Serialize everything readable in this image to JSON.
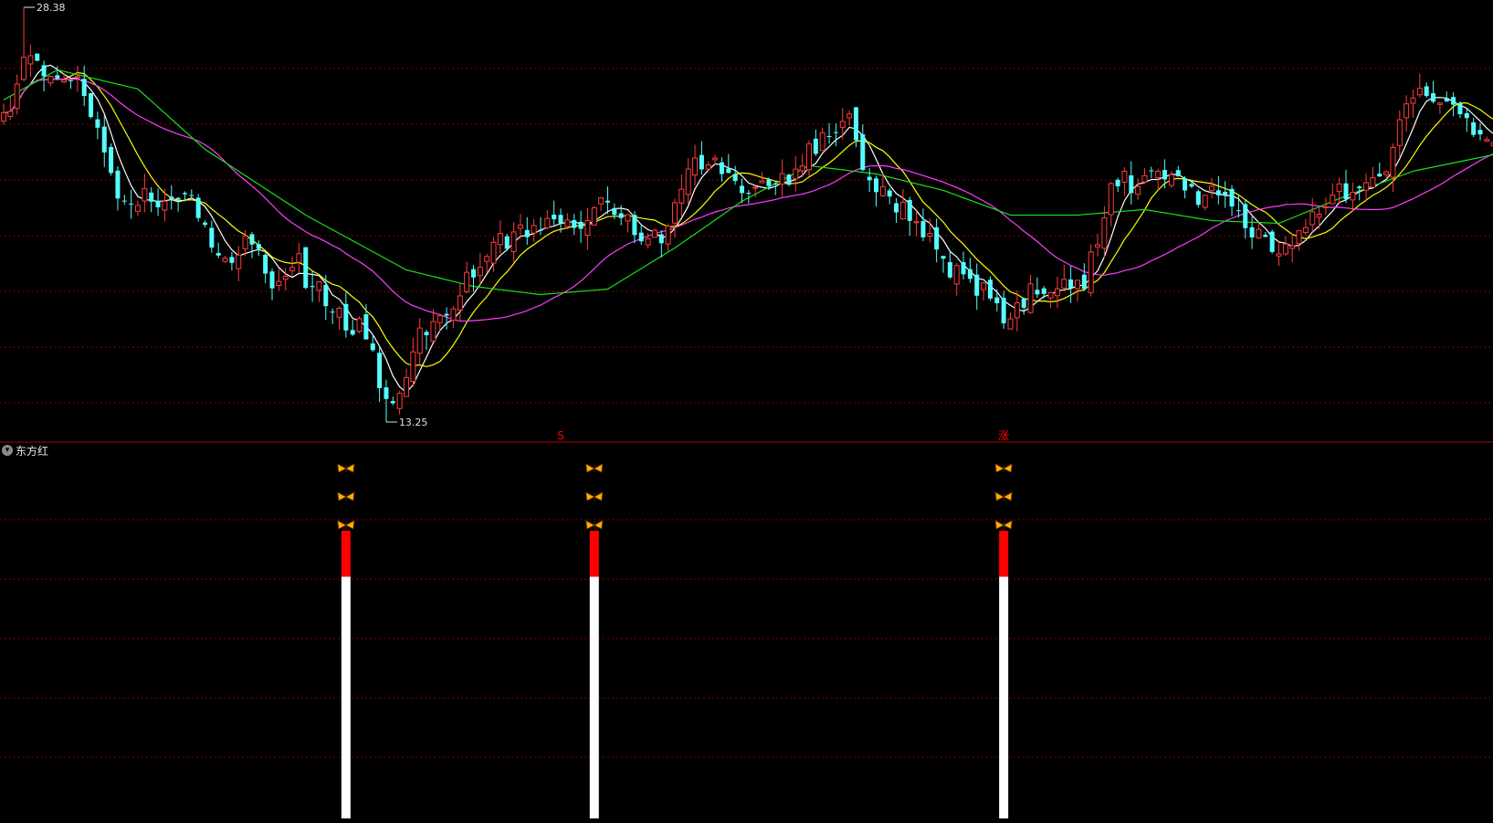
{
  "indicator": {
    "name": "东方红",
    "toggle_icon": "chevron-down-icon"
  },
  "colors": {
    "background": "#000000",
    "grid": "#8b0000",
    "separator": "#b00000",
    "candle_up": "#ff3c3c",
    "candle_down": "#54ffff",
    "ma_short": "#ffffff",
    "ma_mid": "#ffff00",
    "ma_long": "#ff3cff",
    "ma_longest": "#19e019",
    "signal_top": "#ff0000",
    "signal_body": "#ffffff",
    "butterfly": "#ffb000"
  },
  "chart_data": [
    {
      "type": "candlestick",
      "ylim": [
        13.25,
        28.38
      ],
      "max_label": "28.38",
      "min_label": "13.25",
      "grid": true,
      "price_anchors": [
        [
          0,
          24.5
        ],
        [
          4,
          26.6
        ],
        [
          8,
          25.8
        ],
        [
          12,
          25.5
        ],
        [
          17,
          21.5
        ],
        [
          22,
          21.1
        ],
        [
          27,
          21.8
        ],
        [
          32,
          19.1
        ],
        [
          36,
          19.7
        ],
        [
          40,
          18.4
        ],
        [
          44,
          19.1
        ],
        [
          48,
          17.3
        ],
        [
          53,
          16.8
        ],
        [
          58,
          13.8
        ],
        [
          62,
          16.4
        ],
        [
          66,
          17.4
        ],
        [
          70,
          18.4
        ],
        [
          74,
          20.1
        ],
        [
          78,
          20.1
        ],
        [
          82,
          20.5
        ],
        [
          86,
          20.2
        ],
        [
          90,
          21.5
        ],
        [
          94,
          20.1
        ],
        [
          98,
          20.0
        ],
        [
          102,
          22.8
        ],
        [
          106,
          22.5
        ],
        [
          110,
          21.9
        ],
        [
          114,
          22.0
        ],
        [
          118,
          22.6
        ],
        [
          122,
          23.9
        ],
        [
          126,
          24.0
        ],
        [
          129,
          22.1
        ],
        [
          133,
          21.1
        ],
        [
          137,
          20.1
        ],
        [
          141,
          18.9
        ],
        [
          145,
          18.4
        ],
        [
          149,
          17.1
        ],
        [
          153,
          18.1
        ],
        [
          157,
          18.2
        ],
        [
          161,
          18.3
        ],
        [
          165,
          21.7
        ],
        [
          169,
          21.9
        ],
        [
          173,
          22.4
        ],
        [
          177,
          21.8
        ],
        [
          181,
          21.5
        ],
        [
          185,
          20.6
        ],
        [
          190,
          19.2
        ],
        [
          194,
          20.4
        ],
        [
          198,
          21.6
        ],
        [
          202,
          21.8
        ],
        [
          206,
          22.3
        ],
        [
          209,
          25.2
        ],
        [
          212,
          25.3
        ],
        [
          215,
          24.9
        ],
        [
          218,
          24.3
        ],
        [
          222,
          23.5
        ]
      ],
      "ma_periods": [
        5,
        10,
        30,
        120
      ],
      "ma_longest_anchors": [
        [
          0,
          25.0
        ],
        [
          8,
          26.1
        ],
        [
          20,
          25.4
        ],
        [
          30,
          23.2
        ],
        [
          45,
          20.8
        ],
        [
          60,
          18.8
        ],
        [
          70,
          18.2
        ],
        [
          80,
          17.9
        ],
        [
          90,
          18.1
        ],
        [
          100,
          19.6
        ],
        [
          110,
          21.3
        ],
        [
          120,
          22.6
        ],
        [
          130,
          22.3
        ],
        [
          140,
          21.7
        ],
        [
          150,
          20.8
        ],
        [
          160,
          20.8
        ],
        [
          170,
          21.0
        ],
        [
          180,
          20.6
        ],
        [
          190,
          20.5
        ],
        [
          200,
          21.5
        ],
        [
          210,
          22.4
        ],
        [
          222,
          23.0
        ]
      ]
    },
    {
      "type": "signal-columns",
      "top_labels": [
        {
          "index": 83,
          "text": "S"
        },
        {
          "index": 149,
          "text": "涨"
        }
      ],
      "columns": [
        {
          "index": 51,
          "red_fraction": 0.16,
          "white_fraction": 0.84,
          "butterflies": 3
        },
        {
          "index": 88,
          "red_fraction": 0.16,
          "white_fraction": 0.84,
          "butterflies": 3
        },
        {
          "index": 149,
          "red_fraction": 0.16,
          "white_fraction": 0.84,
          "butterflies": 3
        }
      ]
    }
  ]
}
